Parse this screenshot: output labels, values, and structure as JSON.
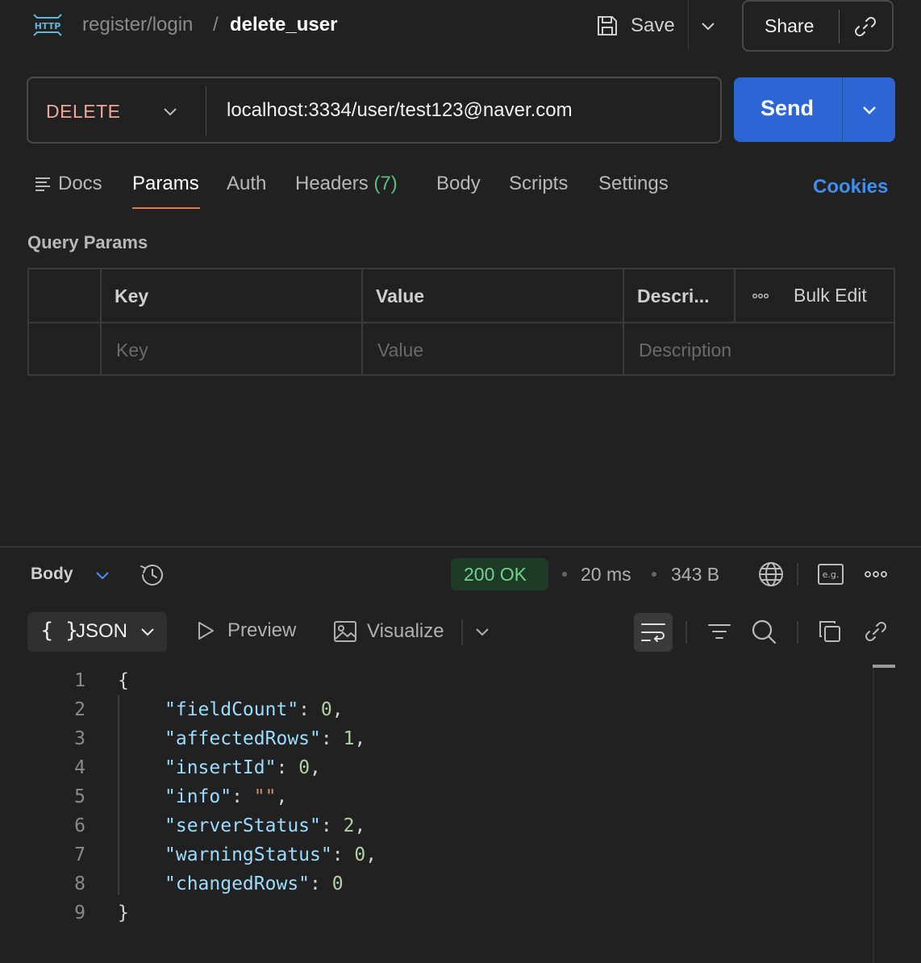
{
  "header": {
    "breadcrumb_parent": "register/login",
    "breadcrumb_sep": "/",
    "breadcrumb_current": "delete_user",
    "save_label": "Save",
    "share_label": "Share"
  },
  "request": {
    "method": "DELETE",
    "url": "localhost:3334/user/test123@naver.com",
    "send_label": "Send",
    "method_color": "#f0a79a"
  },
  "tabs": {
    "docs": "Docs",
    "params": "Params",
    "auth": "Auth",
    "headers": "Headers",
    "headers_count": "(7)",
    "body": "Body",
    "scripts": "Scripts",
    "settings": "Settings",
    "active": "Params",
    "cookies": "Cookies"
  },
  "query_params": {
    "title": "Query Params",
    "columns": [
      "Key",
      "Value",
      "Descri..."
    ],
    "bulk_edit": "Bulk Edit",
    "placeholders": [
      "Key",
      "Value",
      "Description"
    ]
  },
  "response": {
    "body_label": "Body",
    "status": "200 OK",
    "time": "20 ms",
    "size": "343 B",
    "status_color": "#6fd38c",
    "format": "JSON",
    "format_braces": "{ }",
    "preview_label": "Preview",
    "visualize_label": "Visualize",
    "lines": [
      {
        "n": "1",
        "text": "{"
      },
      {
        "n": "2",
        "key": "\"fieldCount\"",
        "val": "0",
        "trail": ","
      },
      {
        "n": "3",
        "key": "\"affectedRows\"",
        "val": "1",
        "trail": ","
      },
      {
        "n": "4",
        "key": "\"insertId\"",
        "val": "0",
        "trail": ","
      },
      {
        "n": "5",
        "key": "\"info\"",
        "val": "\"\"",
        "trail": ",",
        "val_type": "string"
      },
      {
        "n": "6",
        "key": "\"serverStatus\"",
        "val": "2",
        "trail": ","
      },
      {
        "n": "7",
        "key": "\"warningStatus\"",
        "val": "0",
        "trail": ","
      },
      {
        "n": "8",
        "key": "\"changedRows\"",
        "val": "0",
        "trail": ""
      },
      {
        "n": "9",
        "text": "}"
      }
    ]
  },
  "icons": {
    "http": "http-icon",
    "save": "save-icon",
    "link": "link-icon",
    "history": "history-icon",
    "globe": "globe-icon",
    "example": "example-icon",
    "more": "more-icon",
    "wrap": "wrap-icon",
    "filter": "filter-icon",
    "search": "search-icon",
    "copy": "copy-icon"
  }
}
